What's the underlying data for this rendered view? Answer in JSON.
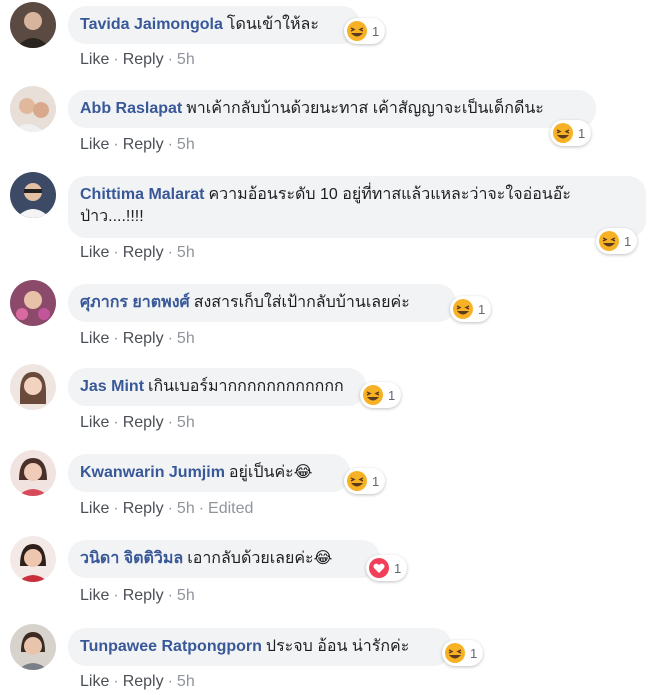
{
  "comments": [
    {
      "author": "Tavida Jaimongola",
      "text": "โดนเข้าให้ละ",
      "reaction_type": "haha",
      "reaction_count": "1",
      "like": "Like",
      "reply": "Reply",
      "time": "5h",
      "edited": ""
    },
    {
      "author": "Abb Raslapat",
      "text": "พาเค้ากลับบ้านด้วยนะทาส เค้าสัญญาจะเป็นเด็กดีนะ",
      "reaction_type": "haha",
      "reaction_count": "1",
      "like": "Like",
      "reply": "Reply",
      "time": "5h",
      "edited": ""
    },
    {
      "author": "Chittima Malarat",
      "text": "ความอ้อนระดับ 10 อยู่ที่ทาสแล้วแหละว่าจะใจอ่อนอ๊ะป่าว....!!!!",
      "reaction_type": "haha",
      "reaction_count": "1",
      "like": "Like",
      "reply": "Reply",
      "time": "5h",
      "edited": ""
    },
    {
      "author": "ศุภากร ยาตพงศ์",
      "text": "สงสารเก็บใส่เป้ากลับบ้านเลยค่ะ",
      "reaction_type": "haha",
      "reaction_count": "1",
      "like": "Like",
      "reply": "Reply",
      "time": "5h",
      "edited": ""
    },
    {
      "author": "Jas Mint",
      "text": "เกินเบอร์มากกกกกกกกกกกก",
      "reaction_type": "haha",
      "reaction_count": "1",
      "like": "Like",
      "reply": "Reply",
      "time": "5h",
      "edited": ""
    },
    {
      "author": "Kwanwarin Jumjim",
      "text": "อยู่เป็นค่ะ😂",
      "reaction_type": "haha",
      "reaction_count": "1",
      "like": "Like",
      "reply": "Reply",
      "time": "5h",
      "edited": "Edited"
    },
    {
      "author": "วนิดา จิตติวิมล",
      "text": "เอากลับด้วยเลยค่ะ😂",
      "reaction_type": "love",
      "reaction_count": "1",
      "like": "Like",
      "reply": "Reply",
      "time": "5h",
      "edited": ""
    },
    {
      "author": "Tunpawee Ratpongporn",
      "text": "ประจบ อ้อน น่ารักค่ะ",
      "reaction_type": "haha",
      "reaction_count": "1",
      "like": "Like",
      "reply": "Reply",
      "time": "5h",
      "edited": ""
    }
  ],
  "colors": {
    "author": "#385898",
    "bubble": "#f2f3f5",
    "meta": "#90949c",
    "love": "#f33e58",
    "haha": "#f7b125"
  }
}
